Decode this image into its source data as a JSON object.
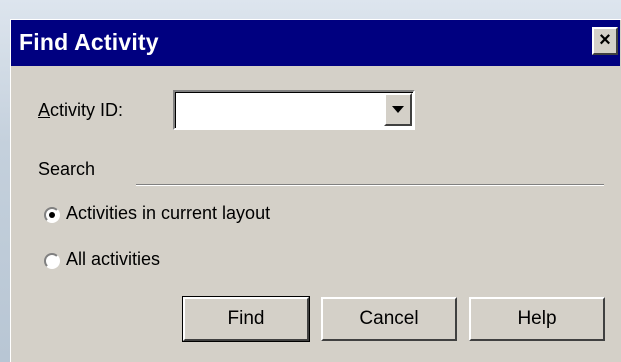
{
  "dialog": {
    "title": "Find Activity",
    "close_label": "×"
  },
  "activity_id": {
    "label_prefix": "A",
    "label_rest": "ctivity ID:",
    "value": ""
  },
  "search": {
    "group_label": "Search",
    "options": [
      {
        "label": "Activities in current layout",
        "checked": true
      },
      {
        "label": "All activities",
        "checked": false
      }
    ]
  },
  "buttons": {
    "find": "Find",
    "cancel": "Cancel",
    "help": "Help"
  }
}
